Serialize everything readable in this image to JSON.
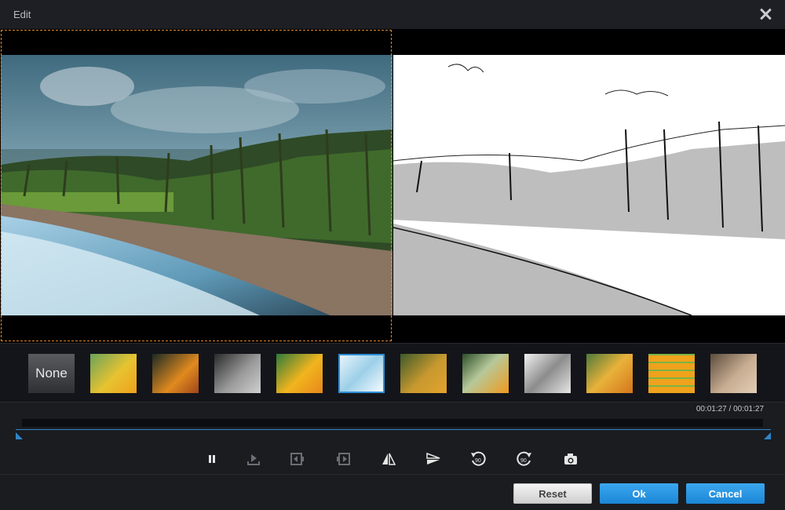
{
  "window": {
    "title": "Edit"
  },
  "filters": [
    {
      "label": "None"
    },
    {
      "label": ""
    },
    {
      "label": ""
    },
    {
      "label": ""
    },
    {
      "label": ""
    },
    {
      "label": ""
    },
    {
      "label": ""
    },
    {
      "label": ""
    },
    {
      "label": ""
    },
    {
      "label": ""
    },
    {
      "label": ""
    },
    {
      "label": ""
    }
  ],
  "selected_filter_index": 5,
  "playback": {
    "time": "00:01:27 / 00:01:27"
  },
  "controls": [
    "pause-icon",
    "play-segment-icon",
    "clip-start-icon",
    "clip-end-icon",
    "flip-horizontal-icon",
    "flip-vertical-icon",
    "rotate-left-90-icon",
    "rotate-right-90-icon",
    "snapshot-icon"
  ],
  "rotate_labels": {
    "left": "90",
    "right": "90"
  },
  "buttons": {
    "reset": "Reset",
    "ok": "Ok",
    "cancel": "Cancel"
  },
  "colors": {
    "accent": "#2d8fd8",
    "crop_border": "#e08a2c",
    "background": "#1b1c20"
  }
}
